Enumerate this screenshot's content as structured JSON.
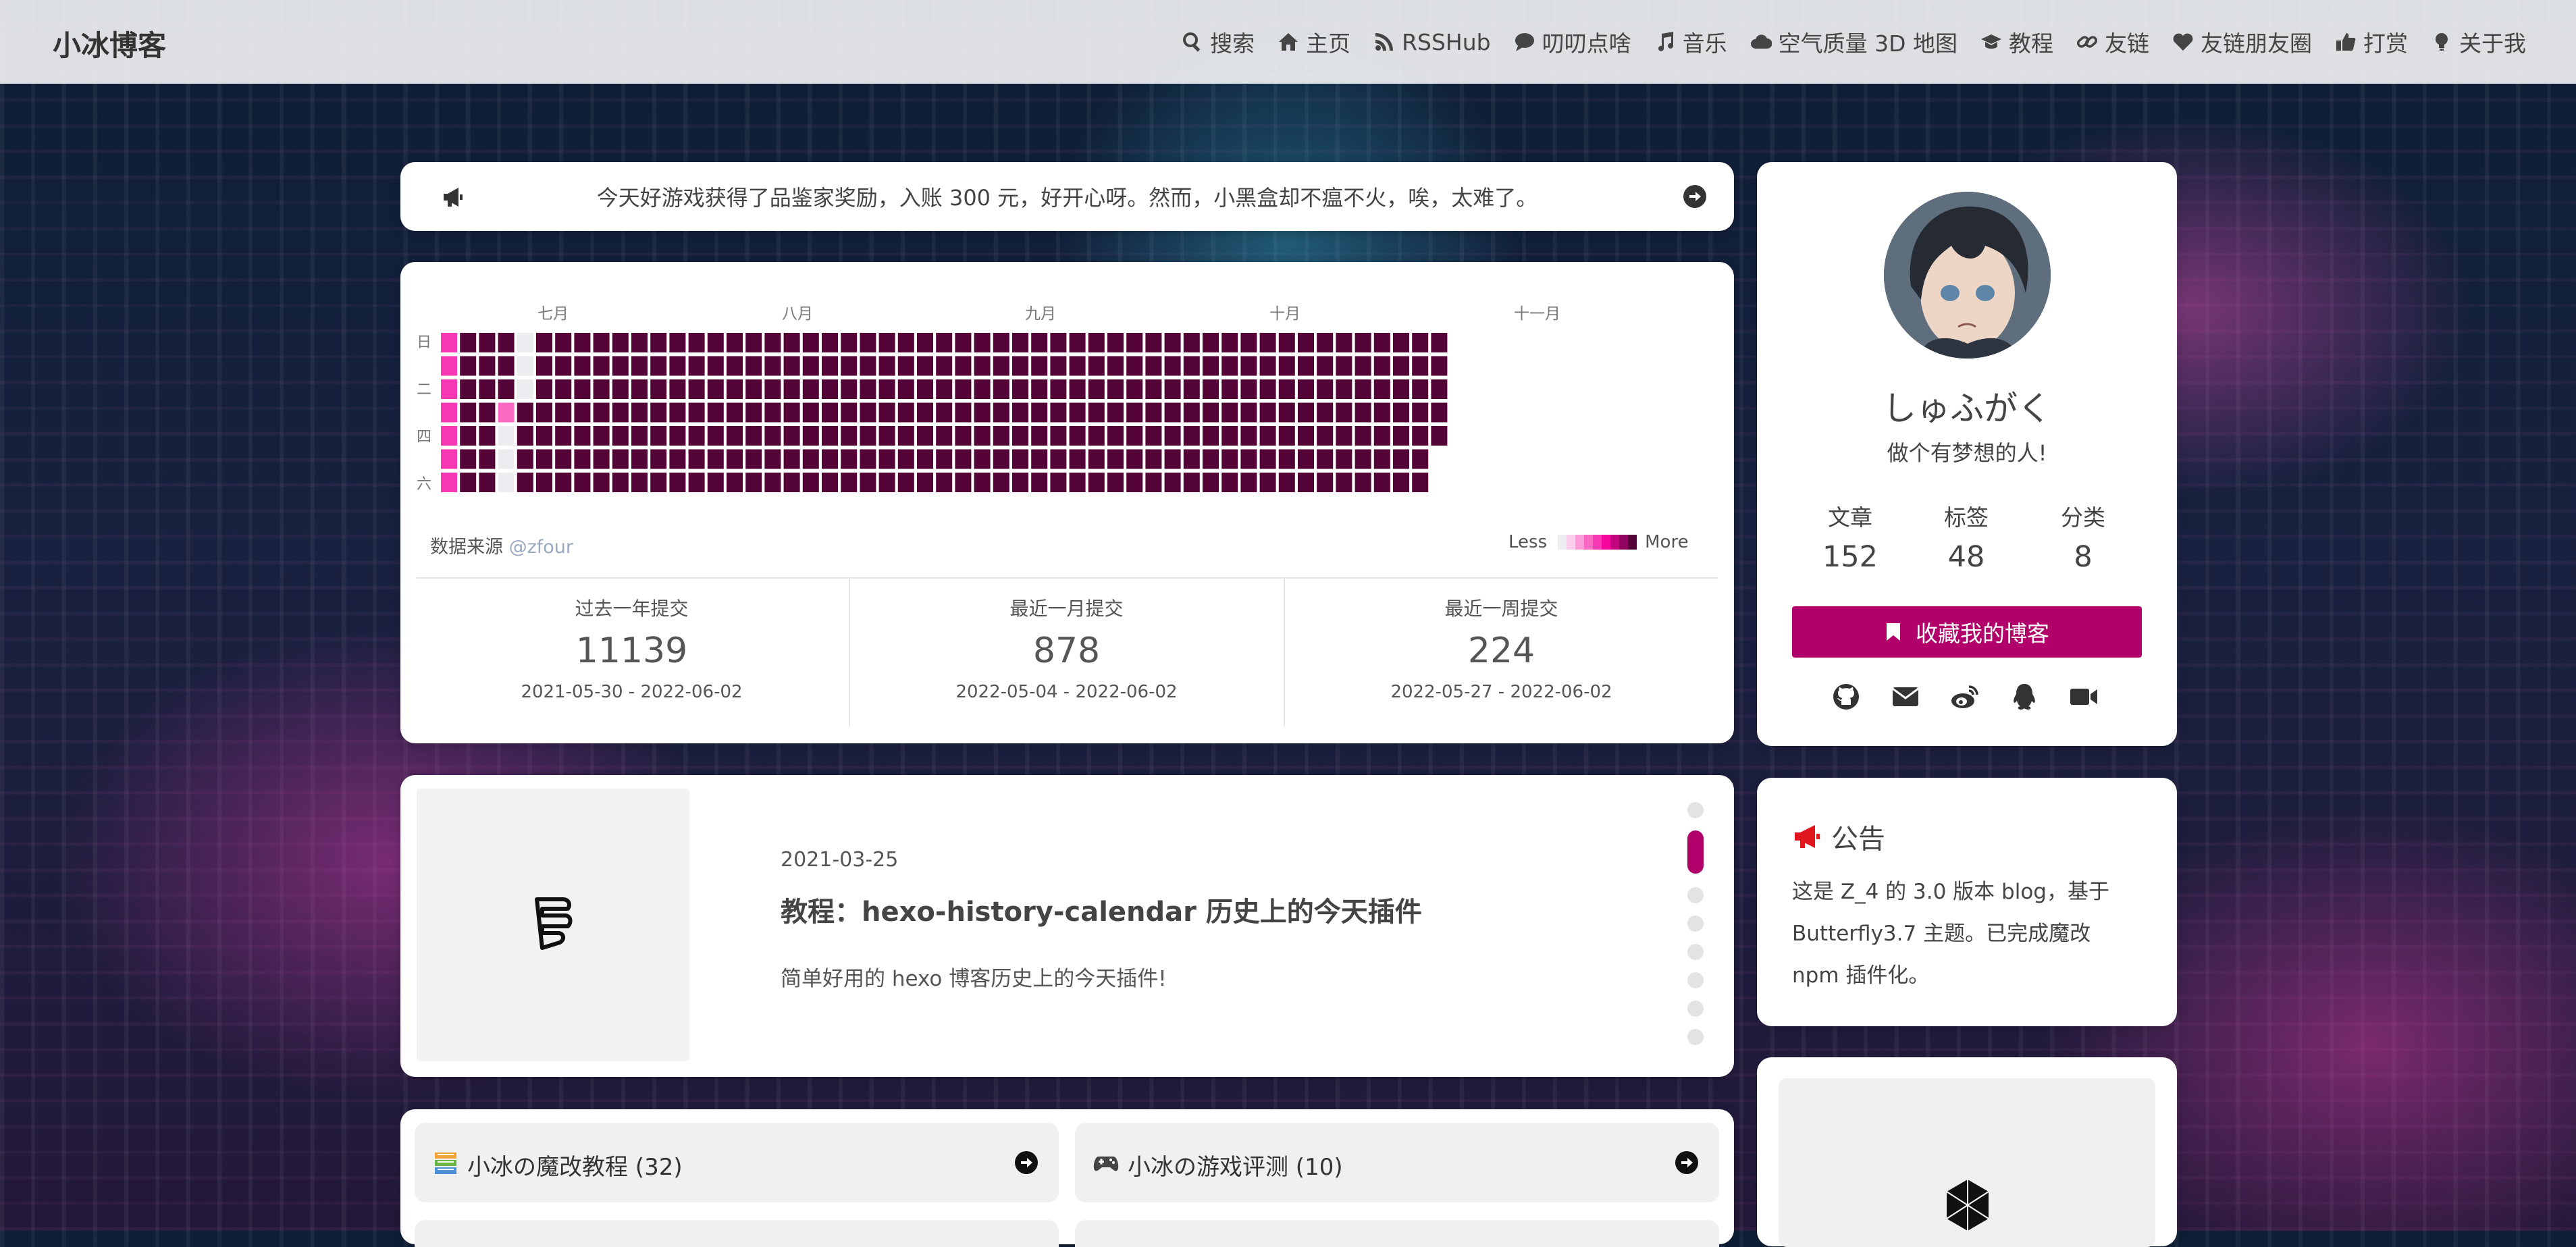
{
  "site": {
    "name": "小冰博客"
  },
  "nav": {
    "items": [
      {
        "label": "搜索",
        "icon": "search-icon"
      },
      {
        "label": "主页",
        "icon": "home-icon"
      },
      {
        "label": "RSSHub",
        "icon": "rss-icon"
      },
      {
        "label": "叨叨点啥",
        "icon": "comment-icon"
      },
      {
        "label": "音乐",
        "icon": "music-icon"
      },
      {
        "label": "空气质量 3D 地图",
        "icon": "cloud-icon"
      },
      {
        "label": "教程",
        "icon": "graduation-cap-icon"
      },
      {
        "label": "友链",
        "icon": "link-icon"
      },
      {
        "label": "友链朋友圈",
        "icon": "heart-icon"
      },
      {
        "label": "打赏",
        "icon": "thumbs-up-icon"
      },
      {
        "label": "关于我",
        "icon": "lightbulb-icon"
      }
    ]
  },
  "notice": {
    "text": "今天好游戏获得了品鉴家奖励，入账 300 元，好开心呀。然而，小黑盒却不瘟不火，唉，太难了。"
  },
  "calendar": {
    "months": [
      "七月",
      "八月",
      "九月",
      "十月",
      "十一月"
    ],
    "weekdays": [
      "日",
      "二",
      "四",
      "六"
    ],
    "source_prefix": "数据来源",
    "source_user": "@zfour",
    "legend_less": "Less",
    "legend_more": "More",
    "colors": [
      "#ebedf0",
      "#fdcdec",
      "#fc9bd9",
      "#fa6ac5",
      "#f838b2",
      "#f5079e",
      "#c4067e",
      "#92055e",
      "#540336"
    ],
    "stats": [
      {
        "label": "过去一年提交",
        "value": "11139",
        "range": "2021-05-30 - 2022-06-02"
      },
      {
        "label": "最近一月提交",
        "value": "878",
        "range": "2022-05-04 - 2022-06-02"
      },
      {
        "label": "最近一周提交",
        "value": "224",
        "range": "2022-05-27 - 2022-06-02"
      }
    ]
  },
  "post": {
    "date": "2021-03-25",
    "title": "教程：hexo-history-calendar 历史上的今天插件",
    "description": "简单好用的 hexo 博客历史上的今天插件!"
  },
  "categories": [
    {
      "label": "小冰の魔改教程 (32)",
      "icon": "book-stack-icon"
    },
    {
      "label": "小冰の游戏评测 (10)",
      "icon": "gamepad-icon"
    }
  ],
  "profile": {
    "name": "しゅふがく",
    "description": "做个有梦想的人!",
    "stats": [
      {
        "label": "文章",
        "value": "152"
      },
      {
        "label": "标签",
        "value": "48"
      },
      {
        "label": "分类",
        "value": "8"
      }
    ],
    "follow_label": "收藏我的博客",
    "social": [
      "github-icon",
      "envelope-icon",
      "weibo-icon",
      "qq-icon",
      "video-icon"
    ]
  },
  "announcement": {
    "title": "公告",
    "body": "这是 Z_4 的 3.0 版本 blog，基于 Butterfly3.7 主题。已完成魔改 npm 插件化。"
  },
  "accent_color": "#b1006a"
}
